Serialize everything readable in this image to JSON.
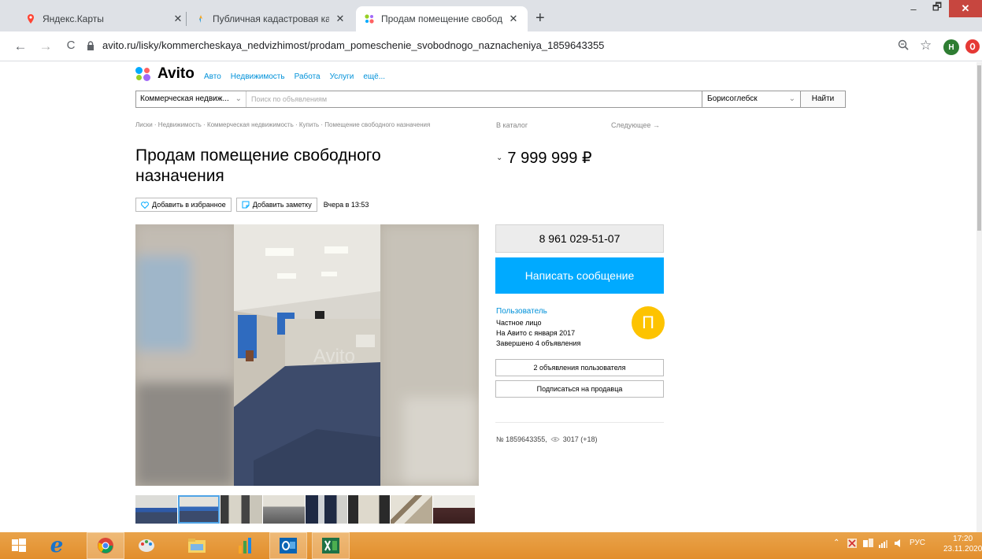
{
  "browser": {
    "tabs": [
      {
        "title": "Яндекс.Карты",
        "close": "✕"
      },
      {
        "title": "Публичная кадастровая карта",
        "close": "✕"
      },
      {
        "title": "Продам помещение свободног",
        "close": "✕"
      }
    ],
    "new_tab": "+",
    "window_controls": {
      "minimize": "–",
      "maximize": "🗗",
      "close": "✕"
    },
    "nav": {
      "back": "←",
      "forward": "→",
      "reload": "C"
    },
    "url": "avito.ru/lisky/kommercheskaya_nedvizhimost/prodam_pomeschenie_svobodnogo_naznacheniya_1859643355",
    "profile_initial": "Н",
    "icons": {
      "zoom": "zoom-icon",
      "bookmark": "star-icon",
      "extension": "opera-icon"
    }
  },
  "site": {
    "logo": "Avito",
    "logo_colors": [
      "#97cf26",
      "#0af",
      "#a169f7",
      "#ff6163"
    ],
    "nav": [
      "Авто",
      "Недвижимость",
      "Работа",
      "Услуги",
      "ещё..."
    ],
    "search": {
      "category": "Коммерческая недвиж...",
      "category_arrow": "⌄",
      "placeholder": "Поиск по объявлениям",
      "city": "Борисоглебск",
      "city_arrow": "⌄",
      "button": "Найти"
    },
    "breadcrumbs": "Лиски · Недвижимость · Коммерческая недвижимость · Купить · Помещение свободного назначения",
    "in_catalog": "В каталог",
    "next": "Следующее →"
  },
  "listing": {
    "title": "Продам помещение свободного назначения",
    "price": "7 999 999 ₽",
    "price_chevron": "⌄",
    "add_favorite": "Добавить в избранное",
    "add_note": "Добавить заметку",
    "posted": "Вчера в 13:53",
    "photo_watermark": "Avito",
    "thumbnail_count": 8,
    "selected_thumbnail": 2,
    "number": "№ 1859643355,",
    "views": "3017 (+18)"
  },
  "seller": {
    "phone": "8 961 029-51-07",
    "message_button": "Написать сообщение",
    "name": "Пользователь",
    "type": "Частное лицо",
    "since": "На Авито с января 2017",
    "completed": "Завершено 4 объявления",
    "avatar_letter": "П",
    "avatar_color": "#fdc300",
    "ads_button": "2 объявления пользователя",
    "subscribe_button": "Подписаться на продавца"
  },
  "taskbar": {
    "apps": [
      "start-icon",
      "internet-explorer-icon",
      "chrome-icon",
      "paint-icon",
      "explorer-icon",
      "chart-app-icon",
      "outlook-icon",
      "excel-icon"
    ],
    "tray_up": "⌃",
    "language": "РУС",
    "time": "17:20",
    "date": "23.11.2020"
  },
  "colors": {
    "accent": "#00aaff",
    "link": "#0091d9",
    "taskbar": "#e28e2c"
  }
}
